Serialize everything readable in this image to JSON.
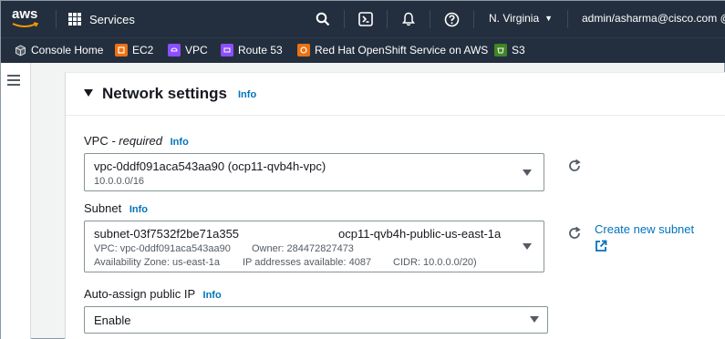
{
  "topnav": {
    "logo_text": "aws",
    "services_label": "Services",
    "icons": [
      "search-icon",
      "cloudshell-icon",
      "notifications-bell-icon",
      "help-icon"
    ],
    "region": "N. Virginia",
    "account": "admin/asharma@cisco.com @"
  },
  "favorites": [
    {
      "label": "Console Home",
      "icon": "cube-icon",
      "color": "#232f3e"
    },
    {
      "label": "EC2",
      "icon": "ec2-icon",
      "color": "#ec7211"
    },
    {
      "label": "VPC",
      "icon": "vpc-icon",
      "color": "#8c4fff"
    },
    {
      "label": "Route 53",
      "icon": "route53-icon",
      "color": "#8c4fff"
    },
    {
      "label": "Red Hat OpenShift Service on AWS",
      "icon": "openshift-icon",
      "color": "#ec7211"
    },
    {
      "label": "S3",
      "icon": "s3-icon",
      "color": "#3f8624"
    }
  ],
  "panel": {
    "title": "Network settings",
    "info": "Info"
  },
  "vpc": {
    "label": "VPC",
    "required": "- required",
    "info": "Info",
    "value": "vpc-0ddf091aca543aa90 (ocp11-qvb4h-vpc)",
    "cidr": "10.0.0.0/16"
  },
  "subnet": {
    "label": "Subnet",
    "info": "Info",
    "id": "subnet-03f7532f2be71a355",
    "name": "ocp11-qvb4h-public-us-east-1a",
    "vpc_line": "VPC: vpc-0ddf091aca543aa90",
    "owner_line": "Owner: 284472827473",
    "az_line": "Availability Zone: us-east-1a",
    "ip_line": "IP addresses available: 4087",
    "cidr_line": "CIDR: 10.0.0.0/20)",
    "create_link": "Create new subnet"
  },
  "auto_ip": {
    "label": "Auto-assign public IP",
    "info": "Info",
    "value": "Enable"
  },
  "colors": {
    "nav_bg": "#232f3e",
    "link": "#0073bb",
    "panel_bg": "#ffffff",
    "page_bg": "#f2f3f3"
  }
}
